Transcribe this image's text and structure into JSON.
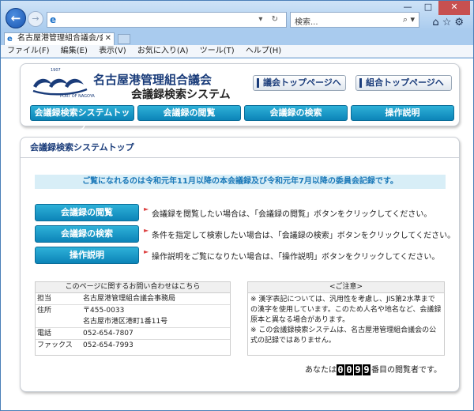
{
  "browser": {
    "search_placeholder": "検索...",
    "tab_title": "名古屋港管理組合議会/会...",
    "menu": [
      "ファイル(F)",
      "編集(E)",
      "表示(V)",
      "お気に入り(A)",
      "ツール(T)",
      "ヘルプ(H)"
    ]
  },
  "header": {
    "since": "1907",
    "logo_caption": "PORT OF NAGOYA",
    "org_title": "名古屋港管理組合議会",
    "system_title": "会議録検索システム",
    "council_top_button": "議会トップページへ",
    "union_top_button": "組合トップページへ"
  },
  "nav": {
    "items": [
      "会議録検索システムトップ",
      "会議録の閲覧",
      "会議録の検索",
      "操作説明"
    ]
  },
  "content": {
    "title": "会議録検索システムトップ",
    "notice": "ご覧になれるのは令和元年11月以降の本会議録及び令和元年7月以降の委員会記録です。",
    "actions": [
      {
        "label": "会議録の閲覧",
        "desc": "会議録を閲覧したい場合は、「会議録の閲覧」ボタンをクリックしてください。"
      },
      {
        "label": "会議録の検索",
        "desc": "条件を指定して検索したい場合は、「会議録の検索」ボタンをクリックしてください。"
      },
      {
        "label": "操作説明",
        "desc": "操作説明をご覧になりたい場合は、「操作説明」ボタンをクリックしてください。"
      }
    ]
  },
  "contact": {
    "heading": "このページに関するお問い合わせはこちら",
    "rows": [
      {
        "label": "担当",
        "value": "名古屋港管理組合議会事務局"
      },
      {
        "label": "住所",
        "value": "〒455-0033"
      },
      {
        "label": "",
        "value": "名古屋市港区港町1番11号"
      },
      {
        "label": "電話",
        "value": "052-654-7807"
      },
      {
        "label": "ファックス",
        "value": "052-654-7993"
      }
    ]
  },
  "caution": {
    "heading": "<ご注意>",
    "text1": "※ 漢字表記については、汎用性を考慮し、JIS第2水準までの漢字を使用しています。このため人名や地名など、会議録原本と異なる場合があります。",
    "text2": "※ この会議録検索システムは、名古屋港管理組合議会の公式の記録ではありません。"
  },
  "counter": {
    "prefix": "あなたは",
    "digits": [
      "0",
      "0",
      "9",
      "9"
    ],
    "suffix": "番目の閲覧者です。"
  }
}
